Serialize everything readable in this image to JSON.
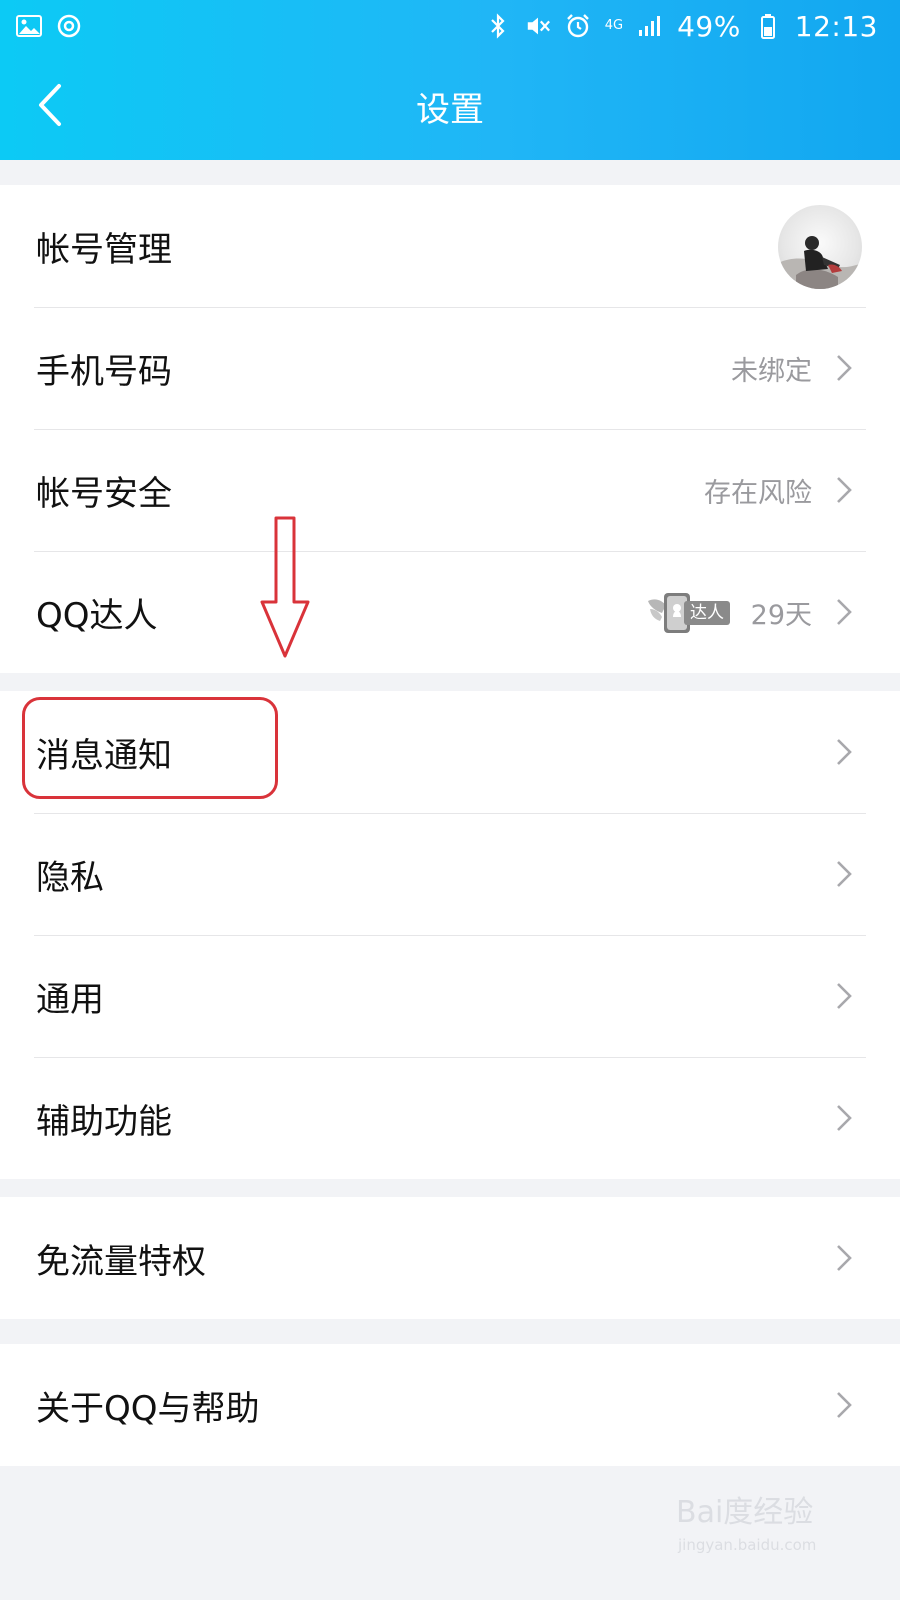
{
  "status_bar": {
    "battery_percent": "49%",
    "time": "12:13",
    "network": "4G"
  },
  "nav": {
    "title": "设置"
  },
  "groups": [
    {
      "rows": [
        {
          "label": "帐号管理",
          "value": ""
        },
        {
          "label": "手机号码",
          "value": "未绑定"
        },
        {
          "label": "帐号安全",
          "value": "存在风险"
        },
        {
          "label": "QQ达人",
          "value": "29天",
          "badge": "达人"
        }
      ]
    },
    {
      "rows": [
        {
          "label": "消息通知",
          "value": ""
        },
        {
          "label": "隐私",
          "value": ""
        },
        {
          "label": "通用",
          "value": ""
        },
        {
          "label": "辅助功能",
          "value": ""
        }
      ]
    },
    {
      "rows": [
        {
          "label": "免流量特权",
          "value": ""
        }
      ]
    },
    {
      "rows": [
        {
          "label": "关于QQ与帮助",
          "value": ""
        }
      ]
    }
  ],
  "watermark": {
    "brand": "Bai度经验",
    "url": "jingyan.baidu.com"
  },
  "colors": {
    "header_start": "#0ccaf5",
    "header_end": "#12a7f0",
    "annotation": "#d9333a"
  }
}
